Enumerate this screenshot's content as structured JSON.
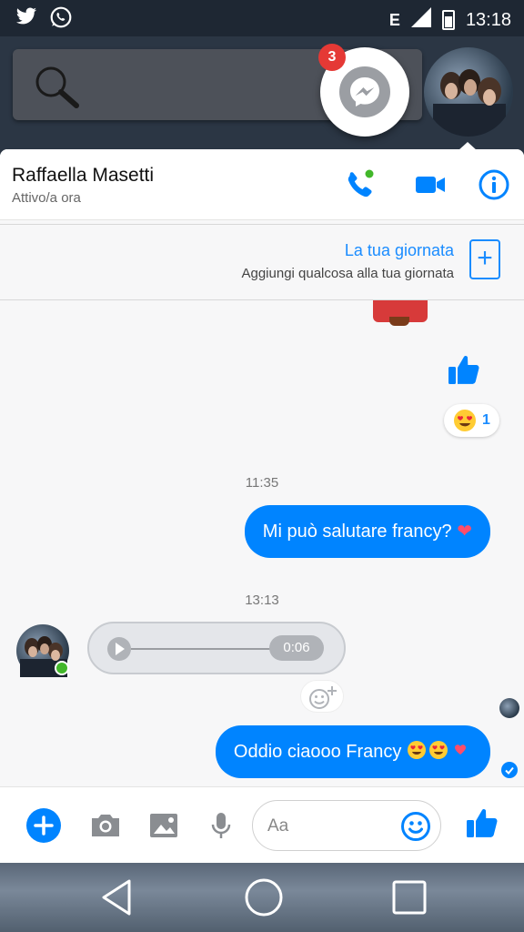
{
  "status_bar": {
    "time": "13:18",
    "network": "E",
    "notification_icons": [
      "twitter-icon",
      "whatsapp-icon"
    ]
  },
  "chat_heads": {
    "unread_count": "3"
  },
  "header": {
    "contact_name": "Raffaella Masetti",
    "status": "Attivo/a ora"
  },
  "story": {
    "title": "La tua giornata",
    "subtitle": "Aggiungi qualcosa alla tua giornata"
  },
  "messages": {
    "reaction_count": "1",
    "timestamp_1": "11:35",
    "msg_1_text": "Mi può salutare francy?",
    "timestamp_2": "13:13",
    "voice_duration": "0:06",
    "msg_2_text": "Oddio ciaooo Francy"
  },
  "composer": {
    "placeholder": "Aa"
  },
  "colors": {
    "accent": "#0084ff",
    "online": "#42b72a",
    "badge": "#e53935"
  }
}
